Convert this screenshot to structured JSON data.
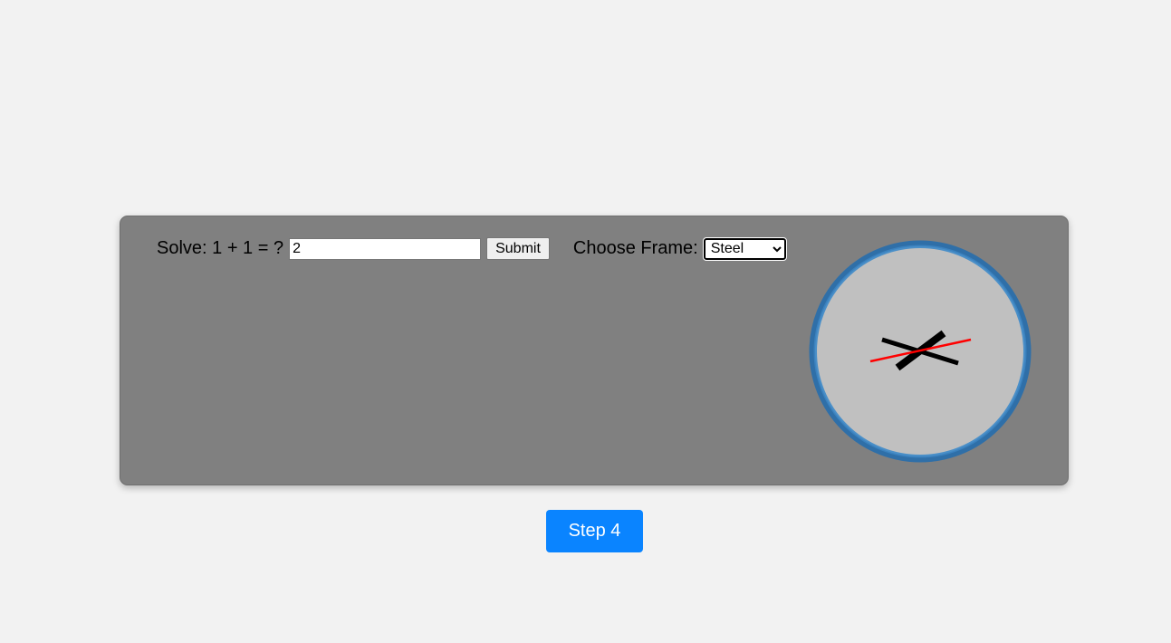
{
  "captcha": {
    "question_label": "Solve: 1 + 1 = ?",
    "answer_value": "2",
    "submit_label": "Submit"
  },
  "frame": {
    "label": "Choose Frame:",
    "selected_option": "Steel"
  },
  "clock": {
    "frame_color": "#3b82bf",
    "face_color": "#c0c0c0",
    "hand_color": "#000000",
    "second_hand_color": "#ff0000"
  },
  "step_button": {
    "label": "Step 4",
    "color": "#0a84ff"
  }
}
